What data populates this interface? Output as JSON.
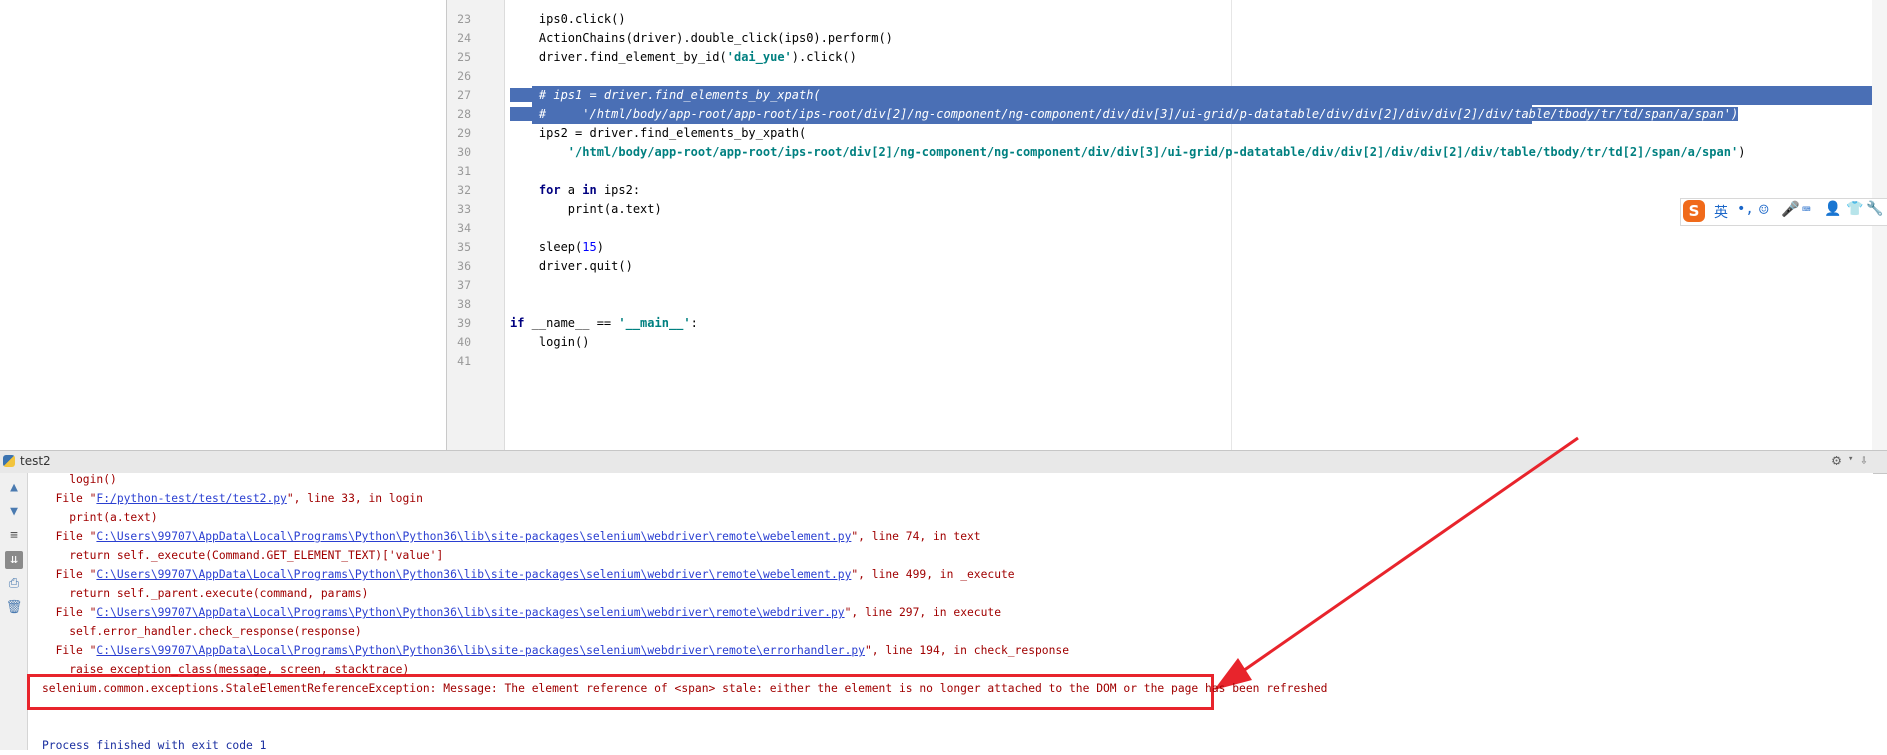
{
  "editor": {
    "lines": [
      {
        "num": "23",
        "text": "    ips0.click()"
      },
      {
        "num": "24",
        "text": "    ActionChains(driver).double_click(ips0).perform()"
      },
      {
        "num": "25",
        "pre": "    driver.find_element_by_id(",
        "str": "'dai_yue'",
        "post": ").click()"
      },
      {
        "num": "26",
        "text": ""
      },
      {
        "num": "27",
        "text": "    # ips1 = driver.find_elements_by_xpath("
      },
      {
        "num": "28",
        "text": "    #     '/html/body/app-root/app-root/ips-root/div[2]/ng-component/ng-component/div/div[3]/ui-grid/p-datatable/div/div[2]/div/div[2]/div/table/tbody/tr/td/span/a/span')"
      },
      {
        "num": "29",
        "text": "    ips2 = driver.find_elements_by_xpath("
      },
      {
        "num": "30",
        "str": "        '/html/body/app-root/app-root/ips-root/div[2]/ng-component/ng-component/div/div[3]/ui-grid/p-datatable/div/div[2]/div/div[2]/div/table/tbody/tr/td[2]/span/a/span'",
        "post": ")"
      },
      {
        "num": "31",
        "text": ""
      },
      {
        "num": "32",
        "kw1": "    for",
        "mid": " a ",
        "kw2": "in",
        "post": " ips2:"
      },
      {
        "num": "33",
        "text": "        print(a.text)"
      },
      {
        "num": "34",
        "text": ""
      },
      {
        "num": "35",
        "pre": "    sleep(",
        "numval": "15",
        "post": ")"
      },
      {
        "num": "36",
        "text": "    driver.quit()"
      },
      {
        "num": "37",
        "text": ""
      },
      {
        "num": "38",
        "text": ""
      },
      {
        "num": "39",
        "kw1": "if",
        "mid": " __name__ == ",
        "str": "'__main__'",
        "post": ":"
      },
      {
        "num": "40",
        "text": "    login()"
      },
      {
        "num": "41",
        "text": ""
      }
    ]
  },
  "run_panel": {
    "title": "test2"
  },
  "console": {
    "lines": [
      {
        "type": "plain",
        "text": "    login()"
      },
      {
        "type": "file",
        "pre": "  File \"",
        "link": "F:/python-test/test/test2.py",
        "post": "\", line 33, in login"
      },
      {
        "type": "plain",
        "text": "    print(a.text)"
      },
      {
        "type": "file",
        "pre": "  File \"",
        "link": "C:\\Users\\99707\\AppData\\Local\\Programs\\Python\\Python36\\lib\\site-packages\\selenium\\webdriver\\remote\\webelement.py",
        "post": "\", line 74, in text"
      },
      {
        "type": "plain",
        "text": "    return self._execute(Command.GET_ELEMENT_TEXT)['value']"
      },
      {
        "type": "file",
        "pre": "  File \"",
        "link": "C:\\Users\\99707\\AppData\\Local\\Programs\\Python\\Python36\\lib\\site-packages\\selenium\\webdriver\\remote\\webelement.py",
        "post": "\", line 499, in _execute"
      },
      {
        "type": "plain",
        "text": "    return self._parent.execute(command, params)"
      },
      {
        "type": "file",
        "pre": "  File \"",
        "link": "C:\\Users\\99707\\AppData\\Local\\Programs\\Python\\Python36\\lib\\site-packages\\selenium\\webdriver\\remote\\webdriver.py",
        "post": "\", line 297, in execute"
      },
      {
        "type": "plain",
        "text": "    self.error_handler.check_response(response)"
      },
      {
        "type": "file",
        "pre": "  File \"",
        "link": "C:\\Users\\99707\\AppData\\Local\\Programs\\Python\\Python36\\lib\\site-packages\\selenium\\webdriver\\remote\\errorhandler.py",
        "post": "\", line 194, in check_response"
      },
      {
        "type": "plain",
        "text": "    raise exception_class(message, screen, stacktrace)"
      },
      {
        "type": "plain",
        "text": "selenium.common.exceptions.StaleElementReferenceException: Message: The element reference of <span> stale: either the element is no longer attached to the DOM or the page has been refreshed"
      },
      {
        "type": "plain",
        "text": ""
      },
      {
        "type": "plain",
        "text": ""
      },
      {
        "type": "exit",
        "text": "Process finished with exit code 1"
      }
    ]
  },
  "ime": {
    "logo": "S",
    "mode": "英"
  },
  "colors": {
    "selection": "#4a6fb5",
    "error_text": "#a00000",
    "link": "#2a3fd1",
    "highlight_box": "#e8242c"
  }
}
